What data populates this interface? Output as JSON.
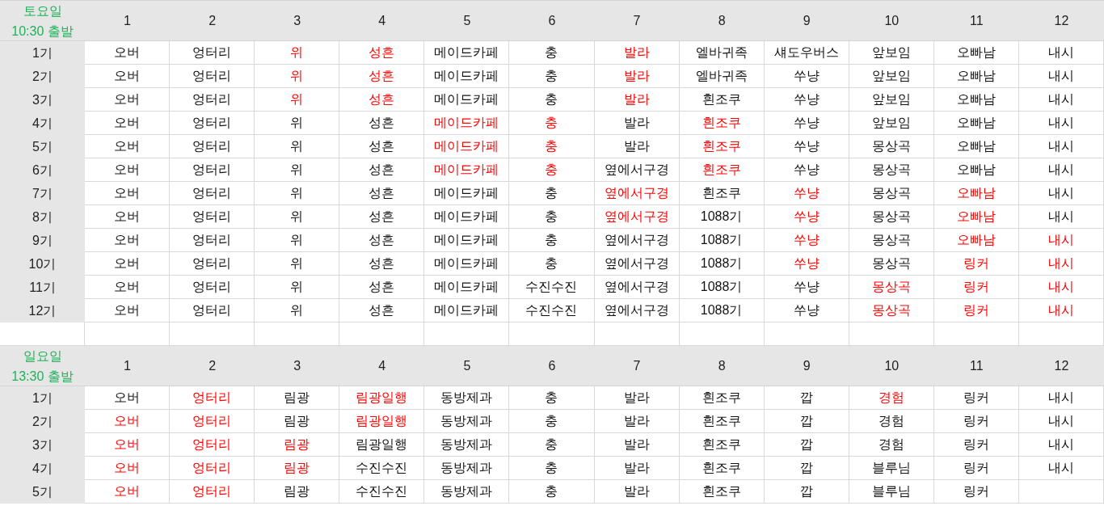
{
  "sections": [
    {
      "day": "토요일",
      "time": "10:30 출발",
      "columns": [
        "1",
        "2",
        "3",
        "4",
        "5",
        "6",
        "7",
        "8",
        "9",
        "10",
        "11",
        "12"
      ],
      "rows": [
        {
          "label": "1기",
          "cells": [
            {
              "text": "오버",
              "highlighted": false
            },
            {
              "text": "엉터리",
              "highlighted": false
            },
            {
              "text": "위",
              "highlighted": true
            },
            {
              "text": "성흔",
              "highlighted": true
            },
            {
              "text": "메이드카페",
              "highlighted": false
            },
            {
              "text": "충",
              "highlighted": false
            },
            {
              "text": "발라",
              "highlighted": true
            },
            {
              "text": "엘바귀족",
              "highlighted": false
            },
            {
              "text": "섀도우버스",
              "highlighted": false
            },
            {
              "text": "앞보임",
              "highlighted": false
            },
            {
              "text": "오빠남",
              "highlighted": false
            },
            {
              "text": "내시",
              "highlighted": false
            }
          ]
        },
        {
          "label": "2기",
          "cells": [
            {
              "text": "오버",
              "highlighted": false
            },
            {
              "text": "엉터리",
              "highlighted": false
            },
            {
              "text": "위",
              "highlighted": true
            },
            {
              "text": "성흔",
              "highlighted": true
            },
            {
              "text": "메이드카페",
              "highlighted": false
            },
            {
              "text": "충",
              "highlighted": false
            },
            {
              "text": "발라",
              "highlighted": true
            },
            {
              "text": "엘바귀족",
              "highlighted": false
            },
            {
              "text": "쑤냥",
              "highlighted": false
            },
            {
              "text": "앞보임",
              "highlighted": false
            },
            {
              "text": "오빠남",
              "highlighted": false
            },
            {
              "text": "내시",
              "highlighted": false
            }
          ]
        },
        {
          "label": "3기",
          "cells": [
            {
              "text": "오버",
              "highlighted": false
            },
            {
              "text": "엉터리",
              "highlighted": false
            },
            {
              "text": "위",
              "highlighted": true
            },
            {
              "text": "성흔",
              "highlighted": true
            },
            {
              "text": "메이드카페",
              "highlighted": false
            },
            {
              "text": "충",
              "highlighted": false
            },
            {
              "text": "발라",
              "highlighted": true
            },
            {
              "text": "흰조쿠",
              "highlighted": false
            },
            {
              "text": "쑤냥",
              "highlighted": false
            },
            {
              "text": "앞보임",
              "highlighted": false
            },
            {
              "text": "오빠남",
              "highlighted": false
            },
            {
              "text": "내시",
              "highlighted": false
            }
          ]
        },
        {
          "label": "4기",
          "cells": [
            {
              "text": "오버",
              "highlighted": false
            },
            {
              "text": "엉터리",
              "highlighted": false
            },
            {
              "text": "위",
              "highlighted": false
            },
            {
              "text": "성흔",
              "highlighted": false
            },
            {
              "text": "메이드카페",
              "highlighted": true
            },
            {
              "text": "충",
              "highlighted": true
            },
            {
              "text": "발라",
              "highlighted": false
            },
            {
              "text": "흰조쿠",
              "highlighted": true
            },
            {
              "text": "쑤냥",
              "highlighted": false
            },
            {
              "text": "앞보임",
              "highlighted": false
            },
            {
              "text": "오빠남",
              "highlighted": false
            },
            {
              "text": "내시",
              "highlighted": false
            }
          ]
        },
        {
          "label": "5기",
          "cells": [
            {
              "text": "오버",
              "highlighted": false
            },
            {
              "text": "엉터리",
              "highlighted": false
            },
            {
              "text": "위",
              "highlighted": false
            },
            {
              "text": "성흔",
              "highlighted": false
            },
            {
              "text": "메이드카페",
              "highlighted": true
            },
            {
              "text": "충",
              "highlighted": true
            },
            {
              "text": "발라",
              "highlighted": false
            },
            {
              "text": "흰조쿠",
              "highlighted": true
            },
            {
              "text": "쑤냥",
              "highlighted": false
            },
            {
              "text": "몽상곡",
              "highlighted": false
            },
            {
              "text": "오빠남",
              "highlighted": false
            },
            {
              "text": "내시",
              "highlighted": false
            }
          ]
        },
        {
          "label": "6기",
          "cells": [
            {
              "text": "오버",
              "highlighted": false
            },
            {
              "text": "엉터리",
              "highlighted": false
            },
            {
              "text": "위",
              "highlighted": false
            },
            {
              "text": "성흔",
              "highlighted": false
            },
            {
              "text": "메이드카페",
              "highlighted": true
            },
            {
              "text": "충",
              "highlighted": true
            },
            {
              "text": "옆에서구경",
              "highlighted": false
            },
            {
              "text": "흰조쿠",
              "highlighted": true
            },
            {
              "text": "쑤냥",
              "highlighted": false
            },
            {
              "text": "몽상곡",
              "highlighted": false
            },
            {
              "text": "오빠남",
              "highlighted": false
            },
            {
              "text": "내시",
              "highlighted": false
            }
          ]
        },
        {
          "label": "7기",
          "cells": [
            {
              "text": "오버",
              "highlighted": false
            },
            {
              "text": "엉터리",
              "highlighted": false
            },
            {
              "text": "위",
              "highlighted": false
            },
            {
              "text": "성흔",
              "highlighted": false
            },
            {
              "text": "메이드카페",
              "highlighted": false
            },
            {
              "text": "충",
              "highlighted": false
            },
            {
              "text": "옆에서구경",
              "highlighted": true
            },
            {
              "text": "흰조쿠",
              "highlighted": false
            },
            {
              "text": "쑤냥",
              "highlighted": true
            },
            {
              "text": "몽상곡",
              "highlighted": false
            },
            {
              "text": "오빠남",
              "highlighted": true
            },
            {
              "text": "내시",
              "highlighted": false
            }
          ]
        },
        {
          "label": "8기",
          "cells": [
            {
              "text": "오버",
              "highlighted": false
            },
            {
              "text": "엉터리",
              "highlighted": false
            },
            {
              "text": "위",
              "highlighted": false
            },
            {
              "text": "성흔",
              "highlighted": false
            },
            {
              "text": "메이드카페",
              "highlighted": false
            },
            {
              "text": "충",
              "highlighted": false
            },
            {
              "text": "옆에서구경",
              "highlighted": true
            },
            {
              "text": "1088기",
              "highlighted": false
            },
            {
              "text": "쑤냥",
              "highlighted": true
            },
            {
              "text": "몽상곡",
              "highlighted": false
            },
            {
              "text": "오빠남",
              "highlighted": true
            },
            {
              "text": "내시",
              "highlighted": false
            }
          ]
        },
        {
          "label": "9기",
          "cells": [
            {
              "text": "오버",
              "highlighted": false
            },
            {
              "text": "엉터리",
              "highlighted": false
            },
            {
              "text": "위",
              "highlighted": false
            },
            {
              "text": "성흔",
              "highlighted": false
            },
            {
              "text": "메이드카페",
              "highlighted": false
            },
            {
              "text": "충",
              "highlighted": false
            },
            {
              "text": "옆에서구경",
              "highlighted": false
            },
            {
              "text": "1088기",
              "highlighted": false
            },
            {
              "text": "쑤냥",
              "highlighted": true
            },
            {
              "text": "몽상곡",
              "highlighted": false
            },
            {
              "text": "오빠남",
              "highlighted": true
            },
            {
              "text": "내시",
              "highlighted": true
            }
          ]
        },
        {
          "label": "10기",
          "cells": [
            {
              "text": "오버",
              "highlighted": false
            },
            {
              "text": "엉터리",
              "highlighted": false
            },
            {
              "text": "위",
              "highlighted": false
            },
            {
              "text": "성흔",
              "highlighted": false
            },
            {
              "text": "메이드카페",
              "highlighted": false
            },
            {
              "text": "충",
              "highlighted": false
            },
            {
              "text": "옆에서구경",
              "highlighted": false
            },
            {
              "text": "1088기",
              "highlighted": false
            },
            {
              "text": "쑤냥",
              "highlighted": true
            },
            {
              "text": "몽상곡",
              "highlighted": false
            },
            {
              "text": "링커",
              "highlighted": true
            },
            {
              "text": "내시",
              "highlighted": true
            }
          ]
        },
        {
          "label": "11기",
          "cells": [
            {
              "text": "오버",
              "highlighted": false
            },
            {
              "text": "엉터리",
              "highlighted": false
            },
            {
              "text": "위",
              "highlighted": false
            },
            {
              "text": "성흔",
              "highlighted": false
            },
            {
              "text": "메이드카페",
              "highlighted": false
            },
            {
              "text": "수진수진",
              "highlighted": false
            },
            {
              "text": "옆에서구경",
              "highlighted": false
            },
            {
              "text": "1088기",
              "highlighted": false
            },
            {
              "text": "쑤냥",
              "highlighted": false
            },
            {
              "text": "몽상곡",
              "highlighted": true
            },
            {
              "text": "링커",
              "highlighted": true
            },
            {
              "text": "내시",
              "highlighted": true
            }
          ]
        },
        {
          "label": "12기",
          "cells": [
            {
              "text": "오버",
              "highlighted": false
            },
            {
              "text": "엉터리",
              "highlighted": false
            },
            {
              "text": "위",
              "highlighted": false
            },
            {
              "text": "성흔",
              "highlighted": false
            },
            {
              "text": "메이드카페",
              "highlighted": false
            },
            {
              "text": "수진수진",
              "highlighted": false
            },
            {
              "text": "옆에서구경",
              "highlighted": false
            },
            {
              "text": "1088기",
              "highlighted": false
            },
            {
              "text": "쑤냥",
              "highlighted": false
            },
            {
              "text": "몽상곡",
              "highlighted": true
            },
            {
              "text": "링커",
              "highlighted": true
            },
            {
              "text": "내시",
              "highlighted": true
            }
          ]
        }
      ]
    },
    {
      "day": "일요일",
      "time": "13:30 출발",
      "columns": [
        "1",
        "2",
        "3",
        "4",
        "5",
        "6",
        "7",
        "8",
        "9",
        "10",
        "11",
        "12"
      ],
      "rows": [
        {
          "label": "1기",
          "cells": [
            {
              "text": "오버",
              "highlighted": false
            },
            {
              "text": "엉터리",
              "highlighted": true
            },
            {
              "text": "림광",
              "highlighted": false
            },
            {
              "text": "림광일행",
              "highlighted": true
            },
            {
              "text": "동방제과",
              "highlighted": false
            },
            {
              "text": "충",
              "highlighted": false
            },
            {
              "text": "발라",
              "highlighted": false
            },
            {
              "text": "흰조쿠",
              "highlighted": false
            },
            {
              "text": "깝",
              "highlighted": false
            },
            {
              "text": "경험",
              "highlighted": true
            },
            {
              "text": "링커",
              "highlighted": false
            },
            {
              "text": "내시",
              "highlighted": false
            }
          ]
        },
        {
          "label": "2기",
          "cells": [
            {
              "text": "오버",
              "highlighted": true
            },
            {
              "text": "엉터리",
              "highlighted": true
            },
            {
              "text": "림광",
              "highlighted": false
            },
            {
              "text": "림광일행",
              "highlighted": true
            },
            {
              "text": "동방제과",
              "highlighted": false
            },
            {
              "text": "충",
              "highlighted": false
            },
            {
              "text": "발라",
              "highlighted": false
            },
            {
              "text": "흰조쿠",
              "highlighted": false
            },
            {
              "text": "깝",
              "highlighted": false
            },
            {
              "text": "경험",
              "highlighted": false
            },
            {
              "text": "링커",
              "highlighted": false
            },
            {
              "text": "내시",
              "highlighted": false
            }
          ]
        },
        {
          "label": "3기",
          "cells": [
            {
              "text": "오버",
              "highlighted": true
            },
            {
              "text": "엉터리",
              "highlighted": true
            },
            {
              "text": "림광",
              "highlighted": true
            },
            {
              "text": "림광일행",
              "highlighted": false
            },
            {
              "text": "동방제과",
              "highlighted": false
            },
            {
              "text": "충",
              "highlighted": false
            },
            {
              "text": "발라",
              "highlighted": false
            },
            {
              "text": "흰조쿠",
              "highlighted": false
            },
            {
              "text": "깝",
              "highlighted": false
            },
            {
              "text": "경험",
              "highlighted": false
            },
            {
              "text": "링커",
              "highlighted": false
            },
            {
              "text": "내시",
              "highlighted": false
            }
          ]
        },
        {
          "label": "4기",
          "cells": [
            {
              "text": "오버",
              "highlighted": true
            },
            {
              "text": "엉터리",
              "highlighted": true
            },
            {
              "text": "림광",
              "highlighted": true
            },
            {
              "text": "수진수진",
              "highlighted": false
            },
            {
              "text": "동방제과",
              "highlighted": false
            },
            {
              "text": "충",
              "highlighted": false
            },
            {
              "text": "발라",
              "highlighted": false
            },
            {
              "text": "흰조쿠",
              "highlighted": false
            },
            {
              "text": "깝",
              "highlighted": false
            },
            {
              "text": "블루님",
              "highlighted": false
            },
            {
              "text": "링커",
              "highlighted": false
            },
            {
              "text": "내시",
              "highlighted": false
            }
          ]
        },
        {
          "label": "5기",
          "cells": [
            {
              "text": "오버",
              "highlighted": true
            },
            {
              "text": "엉터리",
              "highlighted": true
            },
            {
              "text": "림광",
              "highlighted": false
            },
            {
              "text": "수진수진",
              "highlighted": false
            },
            {
              "text": "동방제과",
              "highlighted": false
            },
            {
              "text": "충",
              "highlighted": false
            },
            {
              "text": "발라",
              "highlighted": false
            },
            {
              "text": "흰조쿠",
              "highlighted": false
            },
            {
              "text": "깝",
              "highlighted": false
            },
            {
              "text": "블루님",
              "highlighted": false
            },
            {
              "text": "링커",
              "highlighted": false
            }
          ]
        }
      ]
    }
  ]
}
